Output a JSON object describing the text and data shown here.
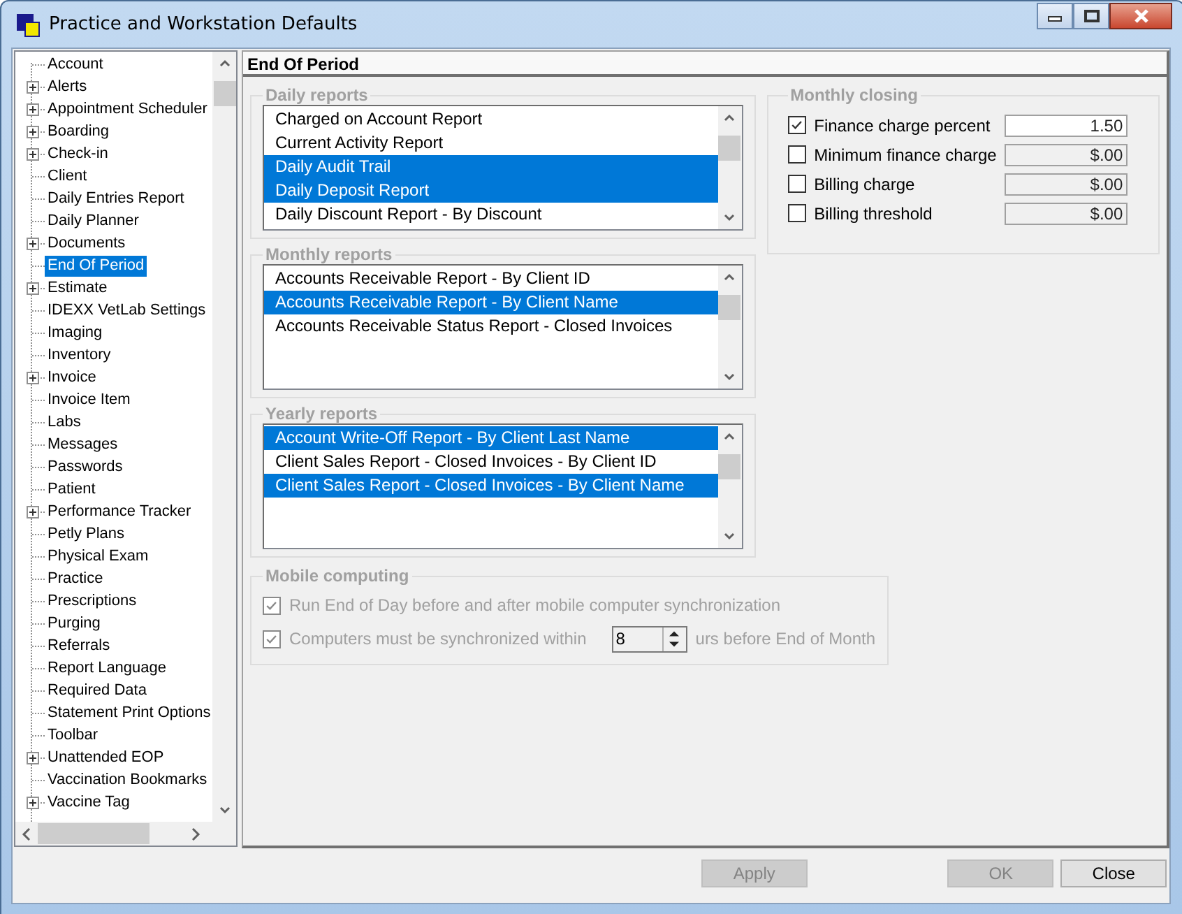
{
  "window": {
    "title": "Practice and Workstation Defaults"
  },
  "tree": {
    "items": [
      {
        "label": "Account",
        "expandable": false,
        "selected": false
      },
      {
        "label": "Alerts",
        "expandable": true,
        "selected": false
      },
      {
        "label": "Appointment Scheduler",
        "expandable": true,
        "selected": false
      },
      {
        "label": "Boarding",
        "expandable": true,
        "selected": false
      },
      {
        "label": "Check-in",
        "expandable": true,
        "selected": false
      },
      {
        "label": "Client",
        "expandable": false,
        "selected": false
      },
      {
        "label": "Daily Entries Report",
        "expandable": false,
        "selected": false
      },
      {
        "label": "Daily Planner",
        "expandable": false,
        "selected": false
      },
      {
        "label": "Documents",
        "expandable": true,
        "selected": false
      },
      {
        "label": "End Of Period",
        "expandable": false,
        "selected": true
      },
      {
        "label": "Estimate",
        "expandable": true,
        "selected": false
      },
      {
        "label": "IDEXX VetLab Settings",
        "expandable": false,
        "selected": false
      },
      {
        "label": "Imaging",
        "expandable": false,
        "selected": false
      },
      {
        "label": "Inventory",
        "expandable": false,
        "selected": false
      },
      {
        "label": "Invoice",
        "expandable": true,
        "selected": false
      },
      {
        "label": "Invoice Item",
        "expandable": false,
        "selected": false
      },
      {
        "label": "Labs",
        "expandable": false,
        "selected": false
      },
      {
        "label": "Messages",
        "expandable": false,
        "selected": false
      },
      {
        "label": "Passwords",
        "expandable": false,
        "selected": false
      },
      {
        "label": "Patient",
        "expandable": false,
        "selected": false
      },
      {
        "label": "Performance Tracker",
        "expandable": true,
        "selected": false
      },
      {
        "label": "Petly Plans",
        "expandable": false,
        "selected": false
      },
      {
        "label": "Physical Exam",
        "expandable": false,
        "selected": false
      },
      {
        "label": "Practice",
        "expandable": false,
        "selected": false
      },
      {
        "label": "Prescriptions",
        "expandable": false,
        "selected": false
      },
      {
        "label": "Purging",
        "expandable": false,
        "selected": false
      },
      {
        "label": "Referrals",
        "expandable": false,
        "selected": false
      },
      {
        "label": "Report Language",
        "expandable": false,
        "selected": false
      },
      {
        "label": "Required Data",
        "expandable": false,
        "selected": false
      },
      {
        "label": "Statement Print Options",
        "expandable": false,
        "selected": false
      },
      {
        "label": "Toolbar",
        "expandable": false,
        "selected": false
      },
      {
        "label": "Unattended EOP",
        "expandable": true,
        "selected": false
      },
      {
        "label": "Vaccination Bookmarks",
        "expandable": false,
        "selected": false
      },
      {
        "label": "Vaccine Tag",
        "expandable": true,
        "selected": false
      }
    ]
  },
  "panel": {
    "heading": "End Of Period"
  },
  "report_groups": [
    {
      "title": "Daily reports",
      "items": [
        {
          "label": "Charged on Account Report",
          "selected": false
        },
        {
          "label": "Current Activity Report",
          "selected": false
        },
        {
          "label": "Daily Audit Trail",
          "selected": true
        },
        {
          "label": "Daily Deposit Report",
          "selected": true
        },
        {
          "label": "Daily Discount Report - By Discount",
          "selected": false
        }
      ]
    },
    {
      "title": "Monthly reports",
      "items": [
        {
          "label": "Accounts Receivable Report - By Client ID",
          "selected": false
        },
        {
          "label": "Accounts Receivable Report - By Client Name",
          "selected": true
        },
        {
          "label": "Accounts Receivable Status Report - Closed Invoices",
          "selected": false
        }
      ]
    },
    {
      "title": "Yearly reports",
      "items": [
        {
          "label": "Account Write-Off Report - By Client Last Name",
          "selected": true
        },
        {
          "label": "Client Sales Report - Closed Invoices - By Client ID",
          "selected": false
        },
        {
          "label": "Client Sales Report - Closed Invoices - By Client Name",
          "selected": true
        }
      ]
    }
  ],
  "monthly_closing": {
    "title": "Monthly closing",
    "rows": [
      {
        "label": "Finance charge percent",
        "checked": true,
        "value": "1.50"
      },
      {
        "label": "Minimum finance charge",
        "checked": false,
        "value": "$.00"
      },
      {
        "label": "Billing charge",
        "checked": false,
        "value": "$.00"
      },
      {
        "label": "Billing threshold",
        "checked": false,
        "value": "$.00"
      }
    ]
  },
  "mobile_computing": {
    "title": "Mobile computing",
    "disabled": true,
    "options": [
      {
        "kind": "plain",
        "label": "Run End of Day before and after mobile computer synchronization",
        "checked": true
      },
      {
        "kind": "spinner",
        "label": "Computers must be synchronized within",
        "value": "8",
        "suffix": "urs before End of Month",
        "checked": true
      }
    ]
  },
  "buttons": [
    {
      "label": "Apply",
      "disabled": true
    },
    {
      "label": "OK",
      "disabled": true
    },
    {
      "label": "Close",
      "disabled": false
    }
  ]
}
